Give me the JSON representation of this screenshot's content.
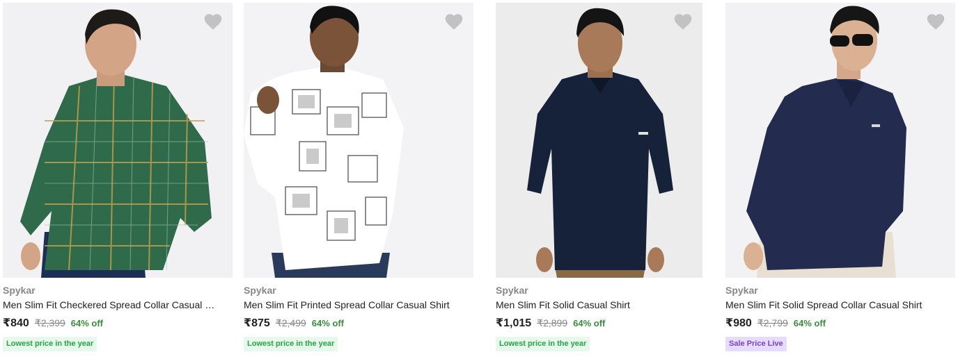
{
  "products": [
    {
      "brand": "Spykar",
      "title": "Men Slim Fit Checkered Spread Collar Casual Shirt",
      "price": "₹840",
      "mrp": "₹2,399",
      "discount": "64% off",
      "tag": "Lowest price in the year",
      "tag_style": "green"
    },
    {
      "brand": "Spykar",
      "title": "Men Slim Fit Printed Spread Collar Casual Shirt",
      "price": "₹875",
      "mrp": "₹2,499",
      "discount": "64% off",
      "tag": "Lowest price in the year",
      "tag_style": "green"
    },
    {
      "brand": "Spykar",
      "title": "Men Slim Fit Solid Casual Shirt",
      "price": "₹1,015",
      "mrp": "₹2,899",
      "discount": "64% off",
      "tag": "Lowest price in the year",
      "tag_style": "green"
    },
    {
      "brand": "Spykar",
      "title": "Men Slim Fit Solid Spread Collar Casual Shirt",
      "price": "₹980",
      "mrp": "₹2,799",
      "discount": "64% off",
      "tag": "Sale Price Live",
      "tag_style": "purple"
    }
  ],
  "icons": {
    "wishlist": "heart-icon"
  },
  "colors": {
    "discount": "#388e3c",
    "tag_green_bg": "#e7f8ec",
    "tag_purple_bg": "#e5dcff"
  }
}
